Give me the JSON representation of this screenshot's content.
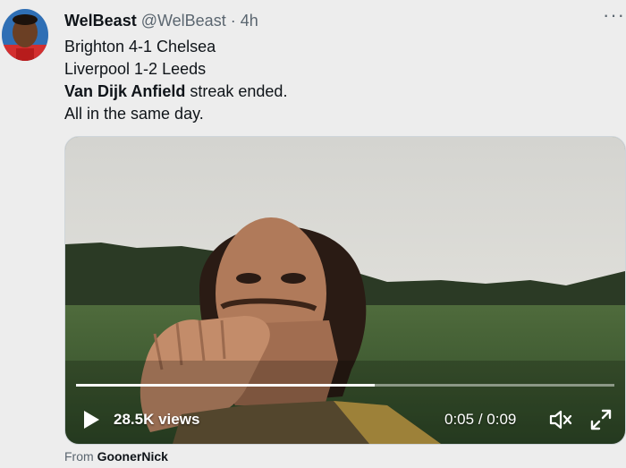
{
  "tweet": {
    "display_name": "WelBeast",
    "handle": "@WelBeast",
    "separator": "·",
    "time": "4h",
    "lines": {
      "l1": "Brighton 4-1 Chelsea",
      "l2": "Liverpool 1-2 Leeds",
      "l3_bold": "Van Dijk Anfield",
      "l3_rest": " streak ended.",
      "l4": "All in the same day."
    }
  },
  "video": {
    "views": "28.5K views",
    "time_current": "0:05",
    "time_sep": " / ",
    "time_total": "0:09",
    "progress": 0.5556,
    "icons": [
      "play-icon",
      "mute-icon",
      "fullscreen-icon"
    ]
  },
  "attribution": {
    "prefix": "From ",
    "source": "GoonerNick"
  },
  "colors": {
    "background": "#ededed",
    "text": "#0f1419",
    "muted": "#5b6670"
  }
}
